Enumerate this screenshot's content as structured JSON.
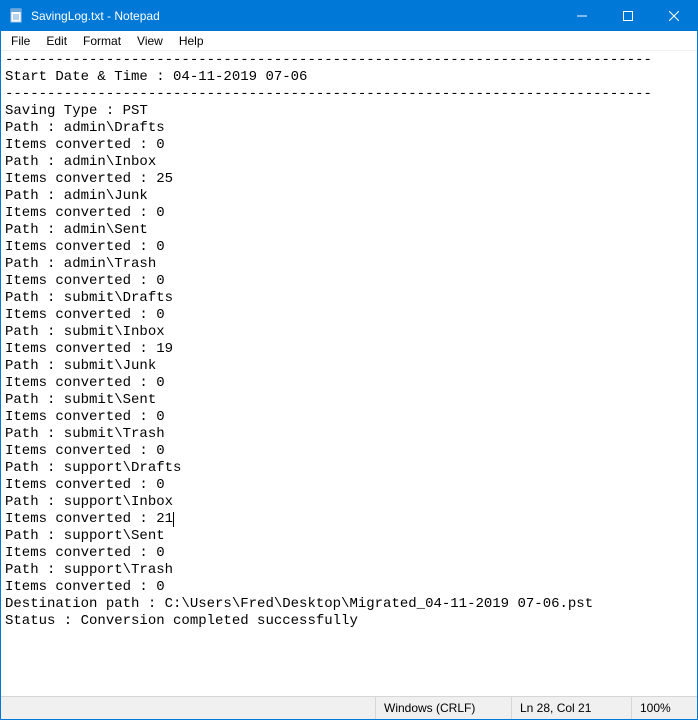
{
  "titlebar": {
    "title": "SavingLog.txt - Notepad"
  },
  "menu": {
    "file": "File",
    "edit": "Edit",
    "format": "Format",
    "view": "View",
    "help": "Help"
  },
  "log": {
    "rule": "-----------------------------------------------------------------------------",
    "start_line": "Start Date & Time : 04-11-2019 07-06",
    "saving_type": "Saving Type : PST",
    "entries": [
      {
        "path": "Path : admin\\Drafts",
        "items": "Items converted : 0"
      },
      {
        "path": "Path : admin\\Inbox",
        "items": "Items converted : 25"
      },
      {
        "path": "Path : admin\\Junk",
        "items": "Items converted : 0"
      },
      {
        "path": "Path : admin\\Sent",
        "items": "Items converted : 0"
      },
      {
        "path": "Path : admin\\Trash",
        "items": "Items converted : 0"
      },
      {
        "path": "Path : submit\\Drafts",
        "items": "Items converted : 0"
      },
      {
        "path": "Path : submit\\Inbox",
        "items": "Items converted : 19"
      },
      {
        "path": "Path : submit\\Junk",
        "items": "Items converted : 0"
      },
      {
        "path": "Path : submit\\Sent",
        "items": "Items converted : 0"
      },
      {
        "path": "Path : submit\\Trash",
        "items": "Items converted : 0"
      },
      {
        "path": "Path : support\\Drafts",
        "items": "Items converted : 0"
      },
      {
        "path": "Path : support\\Inbox",
        "items": "Items converted : 21"
      },
      {
        "path": "Path : support\\Sent",
        "items": "Items converted : 0"
      },
      {
        "path": "Path : support\\Trash",
        "items": "Items converted : 0"
      }
    ],
    "caret_after_index": 11,
    "destination": "Destination path : C:\\Users\\Fred\\Desktop\\Migrated_04-11-2019 07-06.pst",
    "status": "Status : Conversion completed successfully"
  },
  "statusbar": {
    "encoding": "Windows (CRLF)",
    "position": "Ln 28, Col 21",
    "zoom": "100%"
  }
}
